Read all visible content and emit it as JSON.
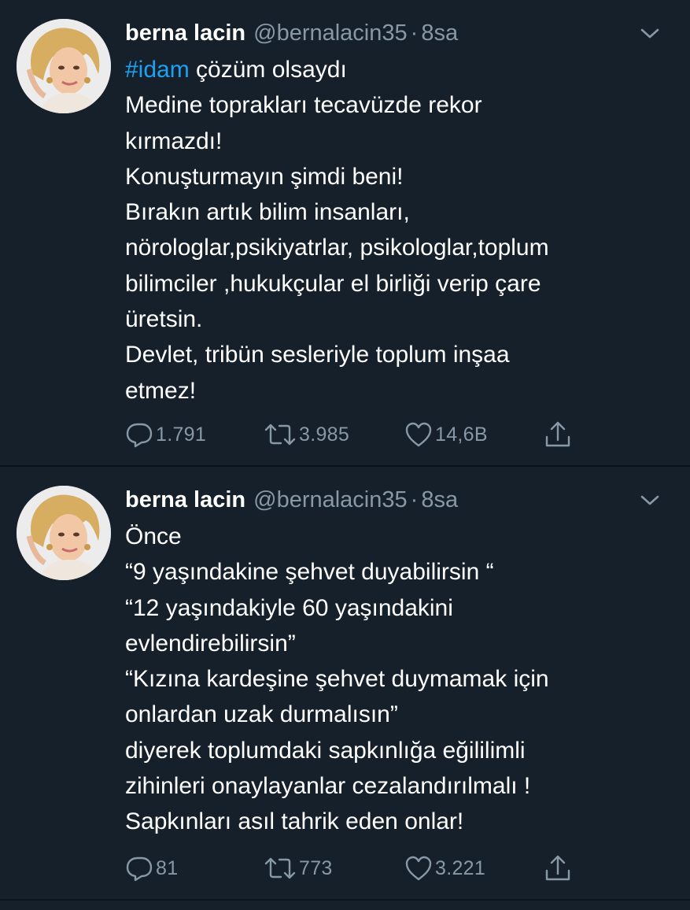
{
  "colors": {
    "background": "#15202b",
    "text": "#ffffff",
    "secondary": "#8899a6",
    "link": "#1da1f2",
    "divider": "#0c151d"
  },
  "tweets": [
    {
      "author_name": "berna lacin",
      "author_handle": "@bernalacin35",
      "separator": "·",
      "time": "8sa",
      "hashtag": "#idam",
      "lines": [
        " çözüm olsaydı",
        "Medine toprakları tecavüzde rekor",
        "kırmazdı!",
        "Konuşturmayın şimdi beni!",
        "Bırakın artık bilim insanları,",
        "nörologlar,psikiyatrlar, psikologlar,toplum",
        "bilimciler ,hukukçular el birliği verip çare",
        "üretsin.",
        "Devlet, tribün sesleriyle toplum inşaa",
        "etmez!"
      ],
      "replies": "1.791",
      "retweets": "3.985",
      "likes": "14,6B",
      "icons": [
        "avatar-photo",
        "chevron-down-icon",
        "reply-icon",
        "retweet-icon",
        "like-icon",
        "share-icon"
      ]
    },
    {
      "author_name": "berna lacin",
      "author_handle": "@bernalacin35",
      "separator": "·",
      "time": "8sa",
      "lines": [
        "Önce",
        "“9 yaşındakine şehvet duyabilirsin “",
        "“12 yaşındakiyle 60 yaşındakini",
        "evlendirebilirsin”",
        "“Kızına kardeşine şehvet duymamak için",
        "onlardan uzak durmalısın”",
        "diyerek toplumdaki sapkınlığa eğililimli",
        "zihinleri onaylayanlar cezalandırılmalı !",
        "Sapkınları asıl tahrik eden onlar!"
      ],
      "replies": "81",
      "retweets": "773",
      "likes": "3.221",
      "icons": [
        "avatar-photo",
        "chevron-down-icon",
        "reply-icon",
        "retweet-icon",
        "like-icon",
        "share-icon"
      ]
    }
  ]
}
